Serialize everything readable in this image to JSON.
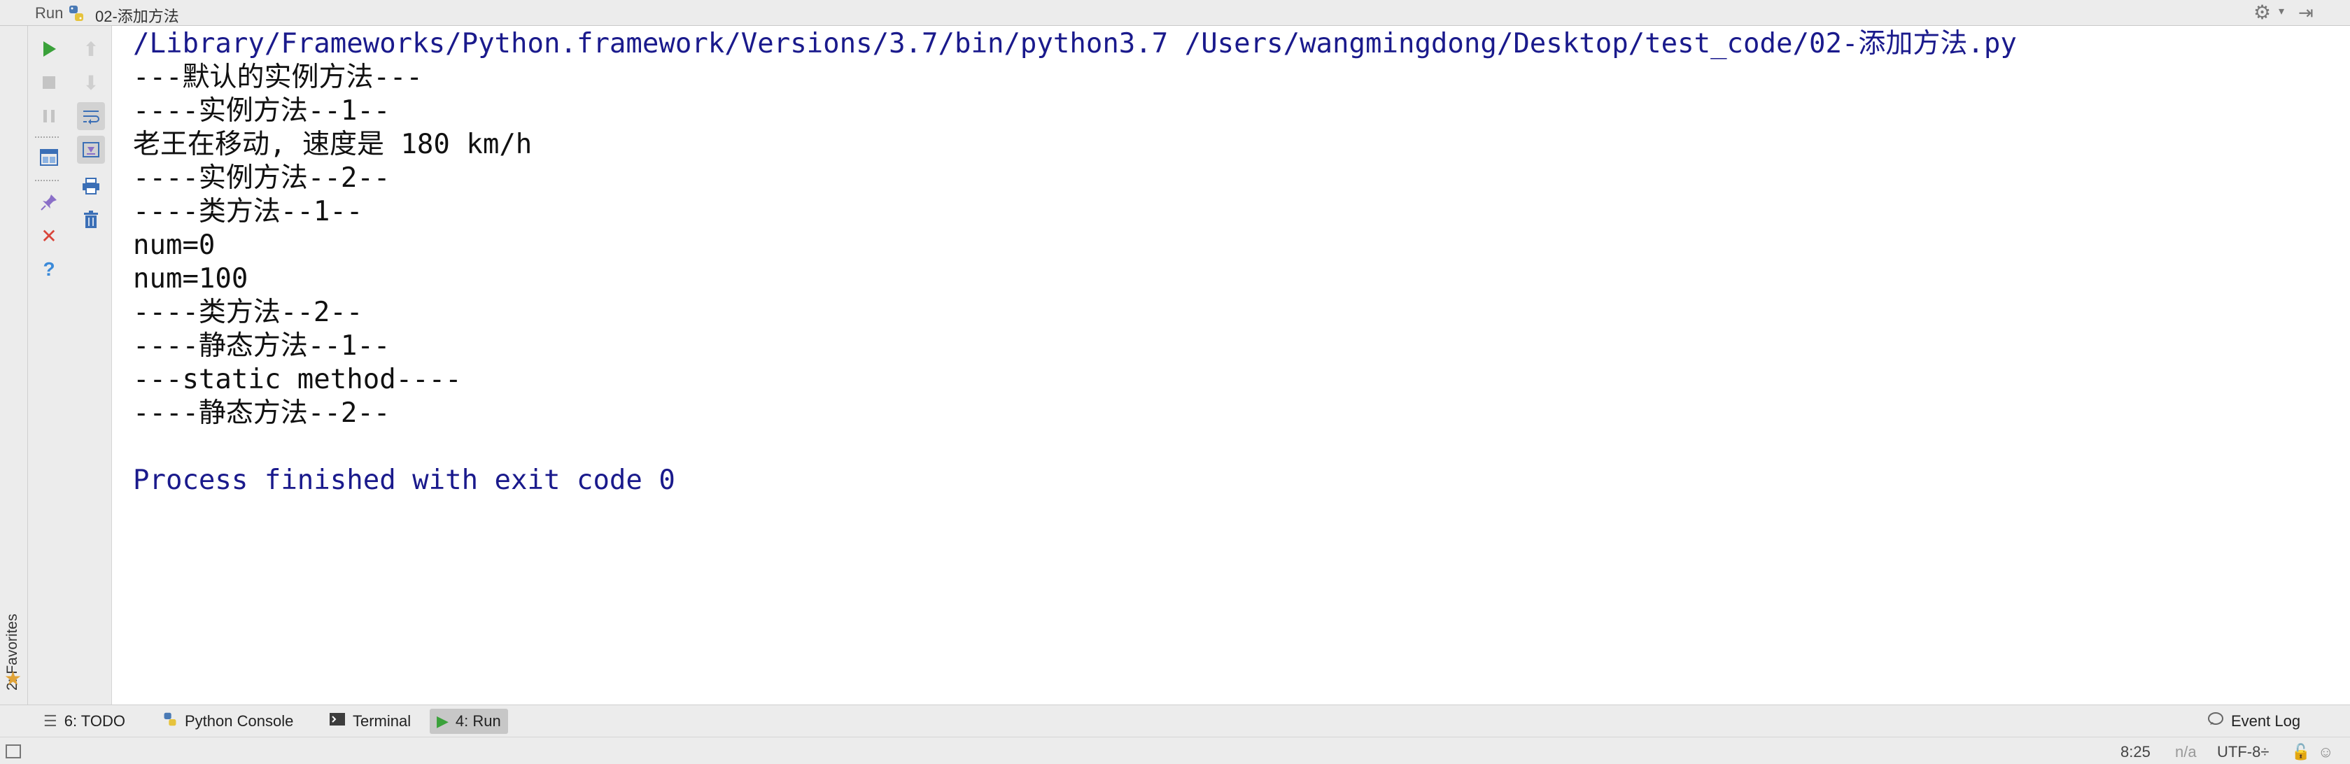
{
  "header": {
    "run_label": "Run",
    "config_name": "02-添加方法"
  },
  "favorites": {
    "label": "2: Favorites"
  },
  "console": {
    "lines": [
      {
        "text": "/Library/Frameworks/Python.framework/Versions/3.7/bin/python3.7 /Users/wangmingdong/Desktop/test_code/02-添加方法.py",
        "kind": "sys"
      },
      {
        "text": "---默认的实例方法---",
        "kind": "out"
      },
      {
        "text": "----实例方法--1--",
        "kind": "out"
      },
      {
        "text": "老王在移动, 速度是 180 km/h",
        "kind": "out"
      },
      {
        "text": "----实例方法--2--",
        "kind": "out"
      },
      {
        "text": "----类方法--1--",
        "kind": "out"
      },
      {
        "text": "num=0",
        "kind": "out"
      },
      {
        "text": "num=100",
        "kind": "out"
      },
      {
        "text": "----类方法--2--",
        "kind": "out"
      },
      {
        "text": "----静态方法--1--",
        "kind": "out"
      },
      {
        "text": "---static method----",
        "kind": "out"
      },
      {
        "text": "----静态方法--2--",
        "kind": "out"
      },
      {
        "text": "",
        "kind": "out"
      },
      {
        "text": "Process finished with exit code 0",
        "kind": "sys"
      }
    ]
  },
  "tool_windows": {
    "todo": "6: TODO",
    "python_console": "Python Console",
    "terminal": "Terminal",
    "run": "4: Run",
    "event_log": "Event Log"
  },
  "status": {
    "position": "8:25",
    "na": "n/a",
    "encoding": "UTF-8÷"
  },
  "colors": {
    "accent_run_green": "#3aa13a",
    "console_system_text": "#1a1a8c",
    "error_red": "#d9453a",
    "help_blue": "#3b8ad9"
  }
}
